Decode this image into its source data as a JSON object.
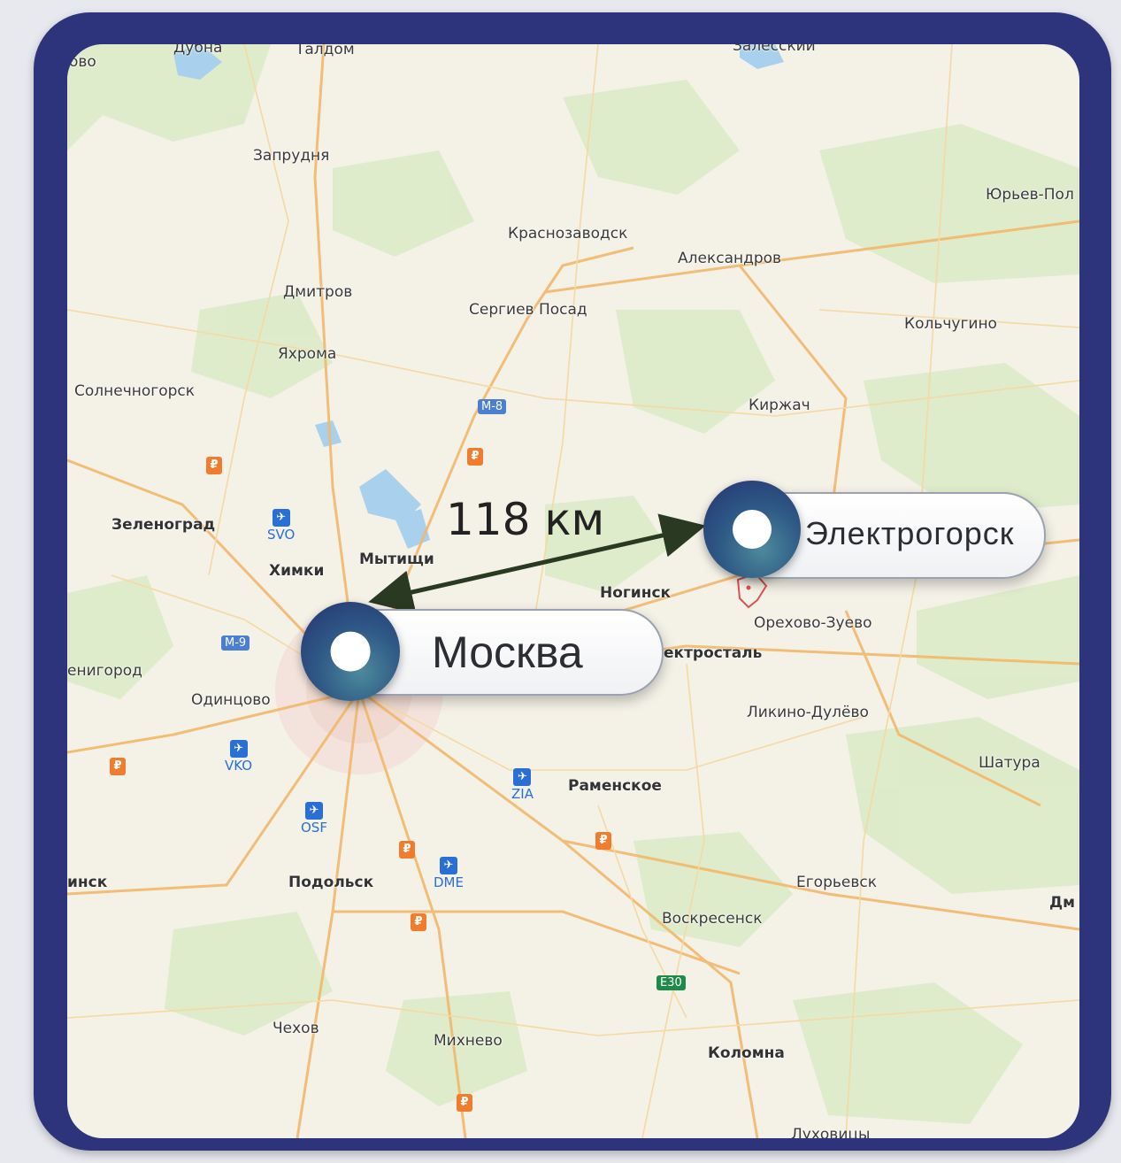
{
  "map": {
    "towns": [
      {
        "id": "dubna",
        "label": "Дубна"
      },
      {
        "id": "taldom",
        "label": "Талдом"
      },
      {
        "id": "zalessky",
        "label": "Залесский"
      },
      {
        "id": "edge-ovo",
        "label": "ово"
      },
      {
        "id": "zaprudnya",
        "label": "Запрудня"
      },
      {
        "id": "yuryev",
        "label": "Юрьев-Пол"
      },
      {
        "id": "krasnozavodsk",
        "label": "Краснозаводск"
      },
      {
        "id": "aleksandrov",
        "label": "Александров"
      },
      {
        "id": "dmitrov",
        "label": "Дмитров"
      },
      {
        "id": "sergiev",
        "label": "Сергиев Посад"
      },
      {
        "id": "kolchugino",
        "label": "Кольчугино"
      },
      {
        "id": "yakhroma",
        "label": "Яхрома"
      },
      {
        "id": "solnechnogorsk",
        "label": "Солнечногорск"
      },
      {
        "id": "kirzhach",
        "label": "Киржач"
      },
      {
        "id": "zelenograd",
        "label": "Зеленоград"
      },
      {
        "id": "khimki",
        "label": "Химки"
      },
      {
        "id": "mytishchi",
        "label": "Мытищи"
      },
      {
        "id": "noginsk",
        "label": "Ногинск"
      },
      {
        "id": "orekhovo",
        "label": "Орехово-Зуево"
      },
      {
        "id": "elektrostal",
        "label": "ектросталь"
      },
      {
        "id": "zvenigorod",
        "label": "енигород"
      },
      {
        "id": "odintsovo",
        "label": "Одинцово"
      },
      {
        "id": "likino",
        "label": "Ликино-Дулёво"
      },
      {
        "id": "shatura",
        "label": "Шатура"
      },
      {
        "id": "ramenskoe",
        "label": "Раменское"
      },
      {
        "id": "edge-insk",
        "label": "инск"
      },
      {
        "id": "podolsk",
        "label": "Подольск"
      },
      {
        "id": "egoryevsk",
        "label": "Егорьевск"
      },
      {
        "id": "edge-dm",
        "label": "Дм"
      },
      {
        "id": "voskresensk",
        "label": "Воскресенск"
      },
      {
        "id": "chekhov",
        "label": "Чехов"
      },
      {
        "id": "mikhnevo",
        "label": "Михнево"
      },
      {
        "id": "kolomna",
        "label": "Коломна"
      },
      {
        "id": "lukhovitsy",
        "label": "Луховицы"
      }
    ],
    "road_shields": [
      {
        "id": "m8",
        "label": "М-8"
      },
      {
        "id": "m9",
        "label": "М-9"
      },
      {
        "id": "e30",
        "label": "E30"
      }
    ],
    "airports": [
      {
        "id": "svo",
        "code": "SVO"
      },
      {
        "id": "vko",
        "code": "VKO"
      },
      {
        "id": "osf",
        "code": "OSF"
      },
      {
        "id": "zia",
        "code": "ZIA"
      },
      {
        "id": "dme",
        "code": "DME"
      }
    ],
    "fuel_symbol": "₽",
    "plane_symbol": "✈"
  },
  "route": {
    "distance_label": "118 км",
    "origin": "Москва",
    "destination": "Электрогорск"
  },
  "colors": {
    "frame": "#2d347b",
    "pin_outer": "#243270",
    "pin_inner": "#4d8a9c",
    "arrow": "#2a3a22",
    "fuel": "#f07d2e",
    "airport": "#2a6fd6"
  }
}
